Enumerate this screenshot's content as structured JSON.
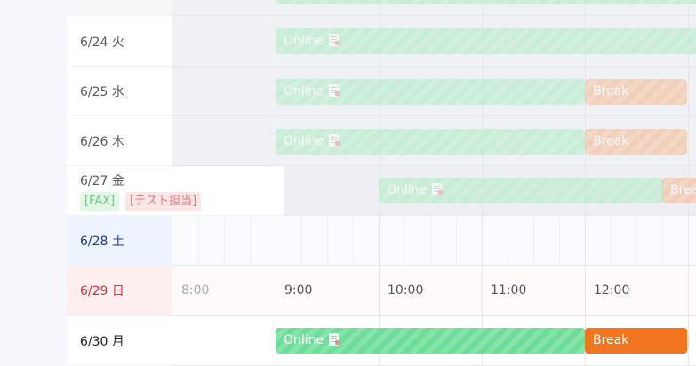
{
  "rows": [
    {
      "date": "",
      "bars": [
        {
          "type": "online",
          "label": ""
        }
      ]
    },
    {
      "date": "6/24 火",
      "bars": [
        {
          "type": "online",
          "label": "Online"
        }
      ]
    },
    {
      "date": "6/25 水",
      "bars": [
        {
          "type": "online",
          "label": "Online"
        },
        {
          "type": "break",
          "label": "Break"
        }
      ]
    },
    {
      "date": "6/26 木",
      "bars": [
        {
          "type": "online",
          "label": "Online"
        },
        {
          "type": "break",
          "label": "Break"
        }
      ]
    },
    {
      "date": "6/27 金",
      "tags": [
        "[FAX]",
        "[テスト担当]"
      ],
      "bars": [
        {
          "type": "online",
          "label": "Online"
        },
        {
          "type": "break",
          "label": "Brea"
        }
      ]
    },
    {
      "date": "6/28 土"
    },
    {
      "date": "6/29 日",
      "hours": [
        "8:00",
        "9:00",
        "10:00",
        "11:00",
        "12:00"
      ]
    },
    {
      "date": "6/30 月",
      "bars": [
        {
          "type": "online",
          "label": "Online"
        },
        {
          "type": "break",
          "label": "Break"
        }
      ]
    }
  ],
  "colors": {
    "saturday": "#1d3a8a",
    "sunday": "#d0313c",
    "online": "#6fdc9a",
    "break": "#f47520"
  },
  "icons": [
    "document-icon"
  ]
}
